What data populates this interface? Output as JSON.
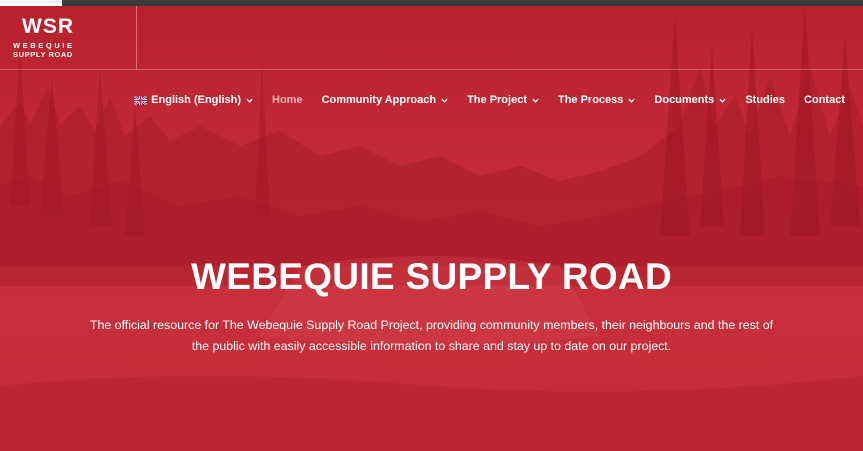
{
  "logo": {
    "line1": "WSR",
    "line2": "WEBEQUIE",
    "line3": "SUPPLY ROAD"
  },
  "nav": {
    "language": "English (English)",
    "items": [
      {
        "label": "Home"
      },
      {
        "label": "Community Approach"
      },
      {
        "label": "The Project"
      },
      {
        "label": "The Process"
      },
      {
        "label": "Documents"
      },
      {
        "label": "Studies"
      },
      {
        "label": "Contact"
      }
    ]
  },
  "hero": {
    "title": "WEBEQUIE SUPPLY ROAD",
    "subtitle": "The official resource for The Webequie Supply Road Project, providing community members, their neighbours and the rest of the public with easily accessible information to share and stay up to date on our project."
  },
  "colors": {
    "brand_red": "#c22a35",
    "nav_active": "#f0b6bb",
    "text": "#ffffff"
  },
  "icons": {
    "dropdown": "chevron-down-icon",
    "language": "uk-flag-icon"
  }
}
